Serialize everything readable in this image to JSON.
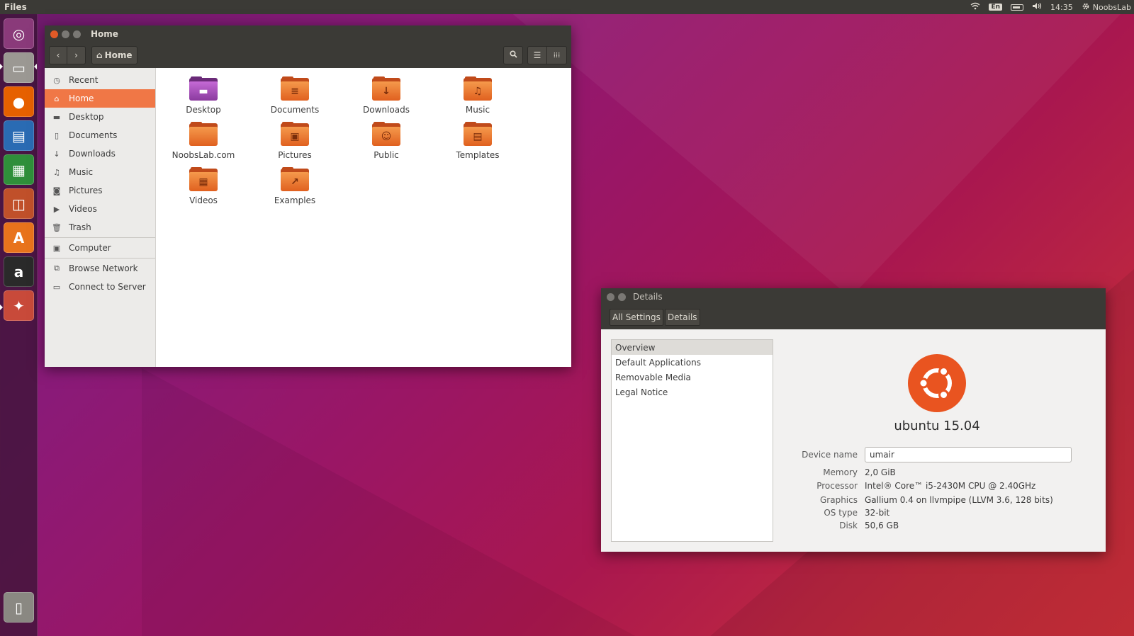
{
  "panel": {
    "app_name": "Files",
    "lang": "En",
    "time": "14:35",
    "user": "NoobsLab"
  },
  "launcher": {
    "items": [
      {
        "name": "Dash",
        "icon": "ubuntu-dash-icon",
        "color": "#8a3a7a"
      },
      {
        "name": "Files",
        "icon": "files-icon",
        "color": "#9b9893"
      },
      {
        "name": "Firefox",
        "icon": "firefox-icon",
        "color": "#e66000"
      },
      {
        "name": "LibreOffice Writer",
        "icon": "writer-icon",
        "color": "#2a6bb3"
      },
      {
        "name": "LibreOffice Calc",
        "icon": "calc-icon",
        "color": "#2f8f3a"
      },
      {
        "name": "LibreOffice Impress",
        "icon": "impress-icon",
        "color": "#c0502a"
      },
      {
        "name": "Ubuntu Software Center",
        "icon": "software-center-icon",
        "color": "#e8731c"
      },
      {
        "name": "Amazon",
        "icon": "amazon-icon",
        "color": "#2a2a2a"
      },
      {
        "name": "System Settings",
        "icon": "system-settings-icon",
        "color": "#c84a3a"
      },
      {
        "name": "Trash",
        "icon": "trash-icon",
        "color": "#8a8882"
      }
    ]
  },
  "files": {
    "title": "Home",
    "path_button": "Home",
    "sidebar": [
      {
        "label": "Recent",
        "icon": "clock-icon",
        "glyph": "◷"
      },
      {
        "label": "Home",
        "icon": "home-icon",
        "glyph": "⌂",
        "active": true
      },
      {
        "label": "Desktop",
        "icon": "folder-icon",
        "glyph": "▬"
      },
      {
        "label": "Documents",
        "icon": "document-icon",
        "glyph": "▯"
      },
      {
        "label": "Downloads",
        "icon": "download-icon",
        "glyph": "↓"
      },
      {
        "label": "Music",
        "icon": "music-icon",
        "glyph": "♫"
      },
      {
        "label": "Pictures",
        "icon": "camera-icon",
        "glyph": "◙"
      },
      {
        "label": "Videos",
        "icon": "video-icon",
        "glyph": "▶"
      },
      {
        "label": "Trash",
        "icon": "trash-icon",
        "glyph": "🗑"
      }
    ],
    "devices": [
      {
        "label": "Computer",
        "icon": "computer-icon",
        "glyph": "▣"
      }
    ],
    "network": [
      {
        "label": "Browse Network",
        "icon": "network-icon",
        "glyph": "⧉"
      },
      {
        "label": "Connect to Server",
        "icon": "server-icon",
        "glyph": "▭"
      }
    ],
    "items": [
      {
        "label": "Desktop",
        "emblem": "",
        "kind": "desk"
      },
      {
        "label": "Documents",
        "emblem": "≡"
      },
      {
        "label": "Downloads",
        "emblem": "↓"
      },
      {
        "label": "Music",
        "emblem": "♫"
      },
      {
        "label": "NoobsLab.com",
        "emblem": ""
      },
      {
        "label": "Pictures",
        "emblem": "▣"
      },
      {
        "label": "Public",
        "emblem": "☺"
      },
      {
        "label": "Templates",
        "emblem": "▤"
      },
      {
        "label": "Videos",
        "emblem": "▦"
      },
      {
        "label": "Examples",
        "emblem": "↗"
      }
    ]
  },
  "details": {
    "title": "Details",
    "breadcrumbs": [
      "All Settings",
      "Details"
    ],
    "sections": [
      "Overview",
      "Default Applications",
      "Removable Media",
      "Legal Notice"
    ],
    "distro": "ubuntu 15.04",
    "device_label": "Device name",
    "device_value": "umair",
    "props": [
      {
        "label": "Memory",
        "value": "2,0 GiB"
      },
      {
        "label": "Processor",
        "value": "Intel® Core™ i5-2430M CPU @ 2.40GHz"
      },
      {
        "label": "Graphics",
        "value": "Gallium 0.4 on llvmpipe (LLVM 3.6, 128 bits)"
      },
      {
        "label": "OS type",
        "value": "32-bit"
      },
      {
        "label": "Disk",
        "value": "50,6 GB"
      }
    ]
  }
}
